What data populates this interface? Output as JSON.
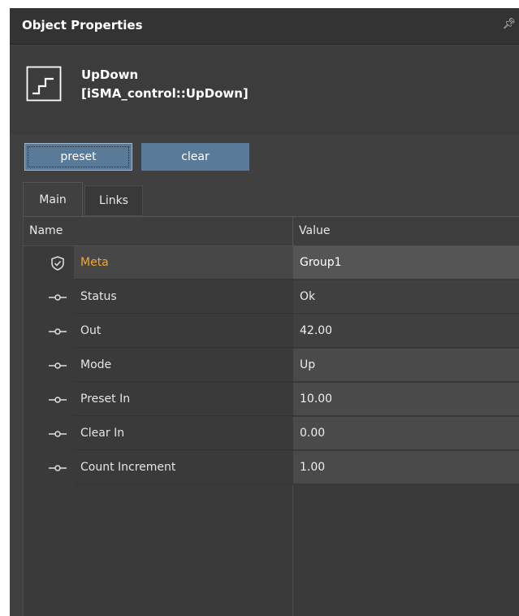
{
  "panel": {
    "title": "Object Properties",
    "pin_icon": "pin-icon"
  },
  "object": {
    "icon": "updown-step-icon",
    "name": "UpDown",
    "type": "[iSMA_control::UpDown]"
  },
  "actions": {
    "preset_label": "preset",
    "clear_label": "clear"
  },
  "tabs": [
    {
      "label": "Main",
      "active": true
    },
    {
      "label": "Links",
      "active": false
    }
  ],
  "grid": {
    "columns": {
      "name": "Name",
      "value": "Value"
    },
    "rows": [
      {
        "icon": "shield-icon",
        "name": "Meta",
        "value": "Group1"
      },
      {
        "icon": "slot-link-icon",
        "name": "Status",
        "value": "Ok"
      },
      {
        "icon": "slot-link-icon",
        "name": "Out",
        "value": "42.00"
      },
      {
        "icon": "slot-link-icon",
        "name": "Mode",
        "value": "Up"
      },
      {
        "icon": "slot-link-icon",
        "name": "Preset In",
        "value": "10.00"
      },
      {
        "icon": "slot-link-icon",
        "name": "Clear In",
        "value": "0.00"
      },
      {
        "icon": "slot-link-icon",
        "name": "Count Increment",
        "value": "1.00"
      }
    ]
  },
  "colors": {
    "accent_button": "#5a7a99",
    "meta_text": "#f0a830",
    "panel_bg": "#404040"
  }
}
